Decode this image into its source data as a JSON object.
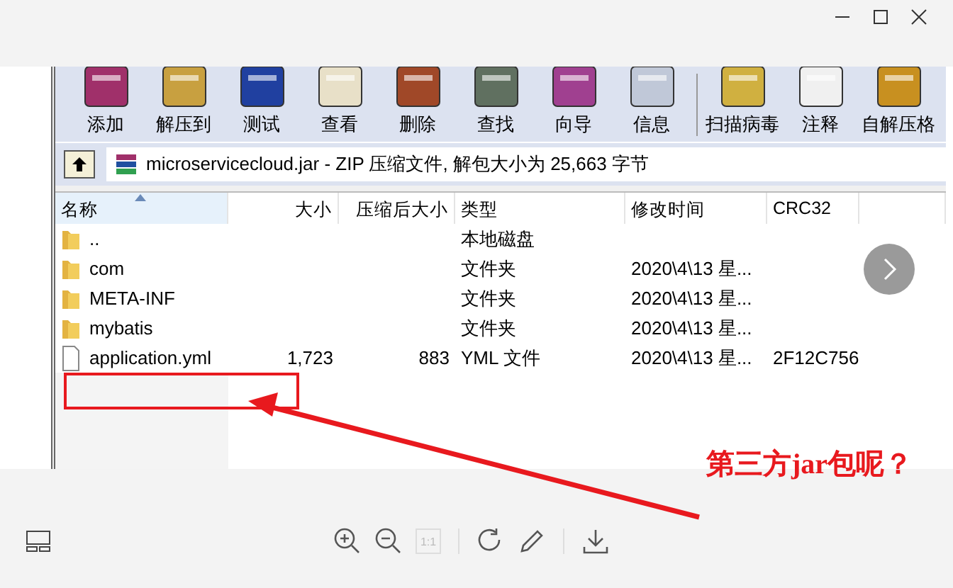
{
  "toolbar": {
    "groups": [
      [
        {
          "label": "添加"
        },
        {
          "label": "解压到"
        },
        {
          "label": "测试"
        },
        {
          "label": "查看"
        },
        {
          "label": "删除"
        },
        {
          "label": "查找"
        },
        {
          "label": "向导"
        },
        {
          "label": "信息"
        }
      ],
      [
        {
          "label": "扫描病毒"
        },
        {
          "label": "注释"
        },
        {
          "label": "自解压格"
        }
      ]
    ]
  },
  "path": {
    "text": "microservicecloud.jar - ZIP 压缩文件, 解包大小为 25,663 字节"
  },
  "columns": [
    {
      "label": "名称",
      "sorted": true
    },
    {
      "label": "大小",
      "sorted": false
    },
    {
      "label": "压缩后大小",
      "sorted": false
    },
    {
      "label": "类型",
      "sorted": false
    },
    {
      "label": "修改时间",
      "sorted": false
    },
    {
      "label": "CRC32",
      "sorted": false
    }
  ],
  "rows": [
    {
      "kind": "folder",
      "name": "..",
      "type": "本地磁盘"
    },
    {
      "kind": "folder",
      "name": "com",
      "type": "文件夹",
      "modified": "2020\\4\\13 星..."
    },
    {
      "kind": "folder",
      "name": "META-INF",
      "type": "文件夹",
      "modified": "2020\\4\\13 星..."
    },
    {
      "kind": "folder",
      "name": "mybatis",
      "type": "文件夹",
      "modified": "2020\\4\\13 星..."
    },
    {
      "kind": "file",
      "name": "application.yml",
      "size": "1,723",
      "packed": "883",
      "type": "YML 文件",
      "modified": "2020\\4\\13 星...",
      "crc": "2F12C756"
    }
  ],
  "annotation": {
    "text": "第三方jar包呢？"
  },
  "viewer": {
    "actual_size": {
      "label": "1:1",
      "disabled": true
    }
  }
}
